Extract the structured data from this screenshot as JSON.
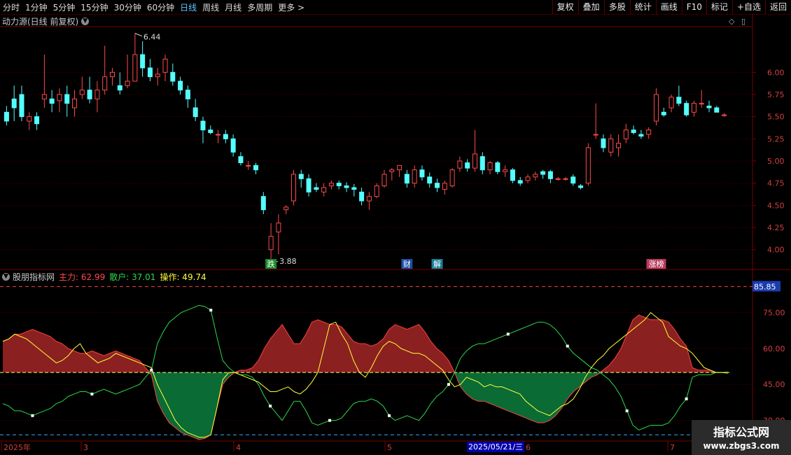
{
  "toolbar": {
    "periods": [
      "分时",
      "1分钟",
      "5分钟",
      "15分钟",
      "30分钟",
      "60分钟",
      "日线",
      "周线",
      "月线",
      "多周期",
      "更多 >"
    ],
    "active_period": "日线",
    "buttons": [
      "复权",
      "叠加",
      "多股",
      "统计",
      "画线",
      "F10",
      "标记",
      "+自选",
      "返回"
    ]
  },
  "main_chart": {
    "title": "动力源(日线 前复权)",
    "high_label": "6.44",
    "low_label": "3.88",
    "price_ticks": [
      "6.00",
      "5.75",
      "5.50",
      "5.25",
      "5.00",
      "4.75",
      "4.50",
      "4.25",
      "4.00"
    ],
    "event_tags": [
      "跌",
      "财",
      "解",
      "涨榜"
    ]
  },
  "indicator": {
    "name": "股朋指标网",
    "main_label": "主力: 62.99",
    "retail_label": "散户: 37.01",
    "op_label": "操作: 49.74",
    "top_value": "85.85",
    "ticks": [
      "75.00",
      "60.00",
      "45.00",
      "30.00"
    ]
  },
  "time_axis": {
    "labels": [
      "2025年",
      "3",
      "4",
      "5",
      "6",
      "7"
    ],
    "selected_date": "2025/05/21/三"
  },
  "watermark": {
    "line1": "指标公式网",
    "line2": "www.zbgs3.com"
  },
  "colors": {
    "up": "#ff4a4a",
    "down": "#54ffff",
    "main_fill": "#8b2020",
    "retail_fill": "#0a6b35"
  },
  "chart_data": {
    "type": "candlestick",
    "price_range": [
      3.8,
      6.5
    ],
    "candles": [
      [
        5.55,
        5.62,
        5.4,
        5.45
      ],
      [
        5.7,
        5.85,
        5.45,
        5.6
      ],
      [
        5.75,
        5.85,
        5.45,
        5.5
      ],
      [
        5.45,
        5.55,
        5.35,
        5.5
      ],
      [
        5.5,
        5.55,
        5.35,
        5.42
      ],
      [
        5.7,
        6.2,
        5.6,
        5.75
      ],
      [
        5.7,
        5.8,
        5.55,
        5.65
      ],
      [
        5.68,
        5.82,
        5.55,
        5.75
      ],
      [
        5.75,
        5.85,
        5.5,
        5.65
      ],
      [
        5.6,
        5.8,
        5.5,
        5.7
      ],
      [
        5.75,
        5.95,
        5.7,
        5.8
      ],
      [
        5.8,
        5.95,
        5.65,
        5.7
      ],
      [
        5.7,
        5.9,
        5.55,
        5.8
      ],
      [
        5.8,
        6.3,
        5.75,
        5.95
      ],
      [
        5.95,
        6.05,
        5.85,
        6.0
      ],
      [
        5.85,
        6.0,
        5.75,
        5.8
      ],
      [
        5.85,
        6.2,
        5.82,
        5.9
      ],
      [
        5.9,
        6.44,
        5.9,
        6.2
      ],
      [
        6.2,
        6.35,
        5.95,
        6.05
      ],
      [
        6.05,
        6.15,
        5.9,
        5.95
      ],
      [
        5.95,
        6.05,
        5.85,
        5.98
      ],
      [
        6.0,
        6.2,
        5.9,
        6.15
      ],
      [
        6.0,
        6.1,
        5.85,
        5.9
      ],
      [
        5.9,
        5.95,
        5.75,
        5.8
      ],
      [
        5.8,
        5.85,
        5.6,
        5.7
      ],
      [
        5.6,
        5.7,
        5.45,
        5.5
      ],
      [
        5.45,
        5.5,
        5.2,
        5.35
      ],
      [
        5.35,
        5.4,
        5.3,
        5.32
      ],
      [
        5.3,
        5.35,
        5.2,
        5.3
      ],
      [
        5.3,
        5.35,
        5.2,
        5.25
      ],
      [
        5.25,
        5.3,
        5.05,
        5.1
      ],
      [
        5.05,
        5.1,
        4.95,
        4.98
      ],
      [
        4.95,
        5.0,
        4.9,
        4.95
      ],
      [
        4.95,
        4.98,
        4.85,
        4.9
      ],
      [
        4.6,
        4.65,
        4.4,
        4.45
      ],
      [
        4.0,
        4.3,
        3.88,
        4.15
      ],
      [
        4.2,
        4.4,
        3.95,
        4.3
      ],
      [
        4.45,
        4.5,
        4.4,
        4.48
      ],
      [
        4.55,
        4.9,
        4.5,
        4.85
      ],
      [
        4.85,
        4.9,
        4.7,
        4.8
      ],
      [
        4.8,
        4.85,
        4.6,
        4.65
      ],
      [
        4.7,
        4.75,
        4.65,
        4.68
      ],
      [
        4.65,
        4.75,
        4.6,
        4.7
      ],
      [
        4.72,
        4.78,
        4.68,
        4.75
      ],
      [
        4.75,
        4.78,
        4.68,
        4.72
      ],
      [
        4.72,
        4.76,
        4.65,
        4.7
      ],
      [
        4.7,
        4.74,
        4.6,
        4.68
      ],
      [
        4.65,
        4.7,
        4.5,
        4.55
      ],
      [
        4.55,
        4.65,
        4.45,
        4.6
      ],
      [
        4.6,
        4.75,
        4.58,
        4.72
      ],
      [
        4.72,
        4.9,
        4.7,
        4.85
      ],
      [
        4.88,
        4.92,
        4.78,
        4.9
      ],
      [
        4.9,
        4.95,
        4.82,
        4.95
      ],
      [
        4.85,
        4.9,
        4.7,
        4.75
      ],
      [
        4.75,
        4.95,
        4.7,
        4.9
      ],
      [
        4.9,
        4.95,
        4.78,
        4.82
      ],
      [
        4.82,
        4.87,
        4.7,
        4.75
      ],
      [
        4.75,
        4.8,
        4.65,
        4.7
      ],
      [
        4.68,
        4.78,
        4.62,
        4.75
      ],
      [
        4.72,
        4.92,
        4.7,
        4.9
      ],
      [
        4.92,
        5.05,
        4.88,
        5.0
      ],
      [
        4.98,
        5.02,
        4.88,
        4.92
      ],
      [
        4.92,
        5.35,
        4.88,
        5.08
      ],
      [
        5.05,
        5.1,
        4.85,
        4.9
      ],
      [
        4.9,
        5.0,
        4.85,
        4.98
      ],
      [
        4.98,
        5.0,
        4.85,
        4.88
      ],
      [
        4.88,
        4.95,
        4.82,
        4.9
      ],
      [
        4.9,
        4.92,
        4.75,
        4.78
      ],
      [
        4.78,
        4.82,
        4.72,
        4.75
      ],
      [
        4.78,
        4.85,
        4.75,
        4.82
      ],
      [
        4.82,
        4.88,
        4.78,
        4.85
      ],
      [
        4.88,
        4.9,
        4.8,
        4.85
      ],
      [
        4.88,
        4.9,
        4.75,
        4.8
      ],
      [
        4.8,
        4.82,
        4.78,
        4.8
      ],
      [
        4.8,
        4.82,
        4.78,
        4.8
      ],
      [
        4.82,
        4.85,
        4.72,
        4.75
      ],
      [
        4.72,
        4.74,
        4.68,
        4.7
      ],
      [
        4.75,
        5.2,
        4.72,
        5.15
      ],
      [
        5.3,
        5.65,
        5.25,
        5.3
      ],
      [
        5.25,
        5.3,
        5.1,
        5.15
      ],
      [
        5.1,
        5.3,
        5.05,
        5.25
      ],
      [
        5.15,
        5.3,
        5.05,
        5.2
      ],
      [
        5.25,
        5.42,
        5.2,
        5.35
      ],
      [
        5.35,
        5.4,
        5.3,
        5.32
      ],
      [
        5.3,
        5.35,
        5.25,
        5.28
      ],
      [
        5.3,
        5.38,
        5.25,
        5.35
      ],
      [
        5.45,
        5.82,
        5.4,
        5.75
      ],
      [
        5.55,
        5.6,
        5.5,
        5.52
      ],
      [
        5.6,
        5.75,
        5.55,
        5.72
      ],
      [
        5.72,
        5.85,
        5.62,
        5.65
      ],
      [
        5.65,
        5.68,
        5.5,
        5.52
      ],
      [
        5.55,
        5.68,
        5.5,
        5.65
      ],
      [
        5.65,
        5.8,
        5.6,
        5.65
      ],
      [
        5.62,
        5.68,
        5.55,
        5.6
      ],
      [
        5.6,
        5.62,
        5.55,
        5.55
      ],
      [
        5.52,
        5.54,
        5.5,
        5.52
      ]
    ],
    "indicator_range": [
      22,
      88
    ],
    "main_series": [
      62.99,
      64,
      66,
      66,
      67,
      68,
      67,
      66,
      65,
      63,
      62,
      60,
      59,
      58,
      58,
      59,
      58,
      57,
      58,
      59,
      58,
      57,
      56,
      55,
      52,
      49,
      38,
      33,
      29,
      27,
      25,
      24,
      23,
      22,
      22.5,
      24,
      35,
      45,
      48,
      50,
      51,
      51,
      52,
      55,
      60,
      64,
      67,
      70,
      66,
      62,
      62,
      66,
      71,
      72,
      71,
      70,
      70,
      69,
      66,
      63,
      62,
      62,
      61,
      62,
      64,
      68,
      70,
      69,
      68,
      69,
      70,
      67,
      63,
      60,
      58,
      55,
      50,
      44,
      41,
      39,
      38,
      38,
      37,
      36,
      35,
      34,
      33,
      32,
      31,
      30,
      29,
      29,
      30,
      32,
      35,
      39,
      42,
      44,
      46,
      48,
      49,
      51,
      53,
      56,
      60,
      66,
      72,
      74,
      73,
      72,
      72,
      72,
      71,
      68,
      64,
      61,
      52,
      51,
      51,
      51,
      50,
      50,
      49.74
    ],
    "retail_series": [
      37.01,
      36,
      34,
      34,
      33,
      32,
      33,
      34,
      35,
      37,
      38,
      40,
      41,
      42,
      42,
      41,
      42,
      43,
      42,
      41,
      42,
      43,
      44,
      45,
      48,
      51,
      62,
      67,
      71,
      73,
      75,
      76,
      77,
      78,
      77.5,
      76,
      65,
      55,
      52,
      50,
      49,
      49,
      48,
      45,
      40,
      36,
      33,
      30,
      34,
      38,
      38,
      34,
      29,
      28,
      29,
      30,
      30,
      31,
      34,
      37,
      38,
      38,
      39,
      38,
      36,
      32,
      30,
      31,
      32,
      31,
      30,
      33,
      37,
      40,
      42,
      45,
      50,
      56,
      59,
      61,
      62,
      62,
      63,
      64,
      65,
      66,
      67,
      68,
      69,
      70,
      71,
      71,
      70,
      68,
      65,
      61,
      58,
      56,
      54,
      52,
      51,
      49,
      47,
      44,
      40,
      34,
      28,
      26,
      27,
      28,
      28,
      28,
      29,
      32,
      36,
      39,
      48,
      49,
      49,
      49,
      50,
      50,
      50.26
    ],
    "op_series": [
      63,
      64,
      66,
      65,
      64,
      62,
      60,
      58,
      56,
      54,
      55,
      57,
      60,
      62,
      58,
      56,
      54,
      55,
      56,
      58,
      57,
      56,
      55,
      54,
      53,
      52,
      45,
      40,
      35,
      30,
      27,
      25,
      24,
      23,
      23,
      24,
      35,
      47,
      50,
      50,
      49,
      48,
      47,
      46,
      44,
      42,
      42,
      43,
      44,
      42,
      41,
      43,
      46,
      50,
      60,
      70,
      71,
      66,
      62,
      55,
      50,
      48,
      52,
      57,
      61,
      63,
      62,
      60,
      59,
      58,
      58,
      57,
      55,
      53,
      51,
      47,
      44,
      45,
      48,
      47,
      46,
      44,
      45,
      44,
      44,
      43,
      42,
      41,
      38,
      36,
      34,
      33,
      32,
      34,
      36,
      37,
      39,
      43,
      48,
      52,
      55,
      57,
      60,
      62,
      64,
      66,
      68,
      70,
      72,
      75,
      73,
      71,
      65,
      63,
      61,
      60,
      58,
      55,
      52,
      51,
      50,
      50,
      49.74
    ],
    "series_names": [
      "主力",
      "散户",
      "操作"
    ]
  }
}
